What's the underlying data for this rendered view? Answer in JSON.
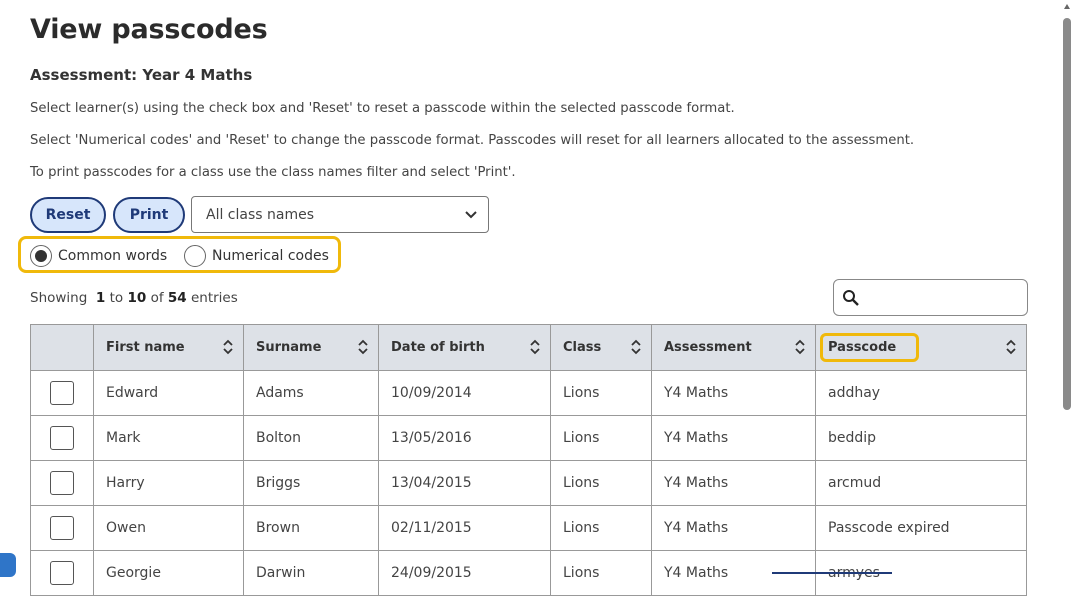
{
  "page": {
    "title": "View passcodes",
    "subtitle": "Assessment: Year 4 Maths",
    "instructions": [
      "Select learner(s) using the check box and 'Reset' to reset a passcode within the selected passcode format.",
      "Select 'Numerical codes' and 'Reset' to change the passcode format. Passcodes will reset for all learners allocated to the assessment.",
      "To print passcodes for a class use the class names filter and select 'Print'."
    ]
  },
  "toolbar": {
    "reset_label": "Reset",
    "print_label": "Print",
    "class_filter": "All class names"
  },
  "format": {
    "common_words": "Common words",
    "numerical_codes": "Numerical codes",
    "selected": "common_words"
  },
  "showing": {
    "prefix": "Showing",
    "from": "1",
    "to_word": "to",
    "to": "10",
    "of_word": "of",
    "total": "54",
    "suffix": "entries"
  },
  "search": {
    "value": ""
  },
  "table": {
    "headers": [
      "First name",
      "Surname",
      "Date of birth",
      "Class",
      "Assessment",
      "Passcode"
    ],
    "rows": [
      {
        "first": "Edward",
        "surname": "Adams",
        "dob": "10/09/2014",
        "class": "Lions",
        "assessment": "Y4 Maths",
        "passcode": "addhay"
      },
      {
        "first": "Mark",
        "surname": "Bolton",
        "dob": "13/05/2016",
        "class": "Lions",
        "assessment": "Y4 Maths",
        "passcode": "beddip"
      },
      {
        "first": "Harry",
        "surname": "Briggs",
        "dob": "13/04/2015",
        "class": "Lions",
        "assessment": "Y4 Maths",
        "passcode": "arcmud"
      },
      {
        "first": "Owen",
        "surname": "Brown",
        "dob": "02/11/2015",
        "class": "Lions",
        "assessment": "Y4 Maths",
        "passcode": "Passcode expired"
      },
      {
        "first": "Georgie",
        "surname": "Darwin",
        "dob": "24/09/2015",
        "class": "Lions",
        "assessment": "Y4 Maths",
        "passcode": "armyes"
      }
    ]
  },
  "colors": {
    "button_bg": "#d7e6fb",
    "button_border": "#1f3a78",
    "highlight": "#f0b90b",
    "header_bg": "#dde1e7"
  }
}
